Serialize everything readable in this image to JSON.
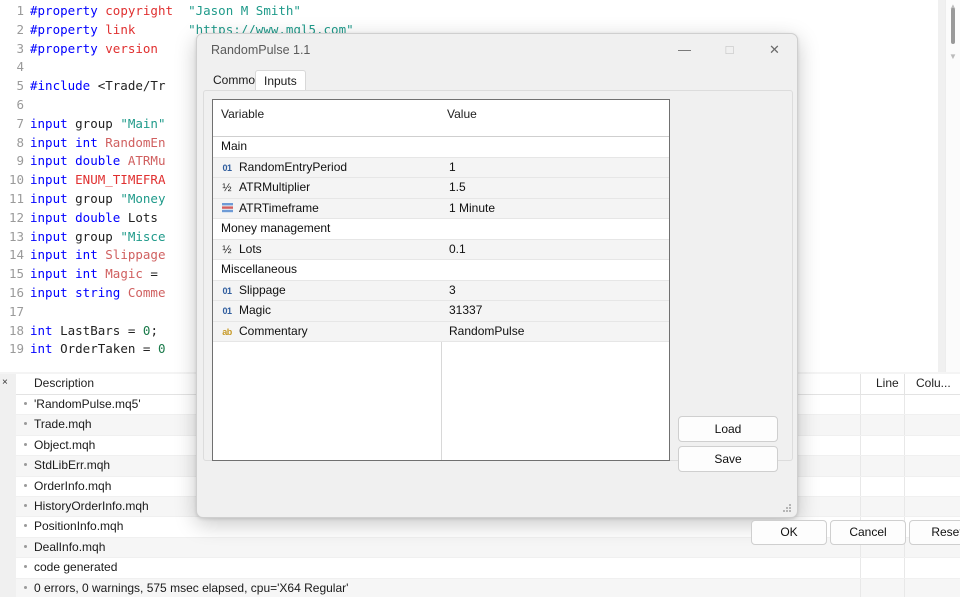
{
  "editor": {
    "lines": [
      {
        "n": "1",
        "tokens": [
          {
            "t": "#property ",
            "c": "pre"
          },
          {
            "t": "copyright",
            "c": "typ"
          },
          {
            "t": "  ",
            "c": "pln"
          },
          {
            "t": "\"Jason M Smith\"",
            "c": "str"
          }
        ]
      },
      {
        "n": "2",
        "tokens": [
          {
            "t": "#property ",
            "c": "pre"
          },
          {
            "t": "link",
            "c": "typ"
          },
          {
            "t": "       ",
            "c": "pln"
          },
          {
            "t": "\"https://www.mql5.com\"",
            "c": "str"
          }
        ]
      },
      {
        "n": "3",
        "tokens": [
          {
            "t": "#property ",
            "c": "pre"
          },
          {
            "t": "version",
            "c": "typ"
          }
        ]
      },
      {
        "n": "4",
        "tokens": []
      },
      {
        "n": "5",
        "tokens": [
          {
            "t": "#include ",
            "c": "pre"
          },
          {
            "t": "<Trade/Tr",
            "c": "pln"
          }
        ]
      },
      {
        "n": "6",
        "tokens": []
      },
      {
        "n": "7",
        "tokens": [
          {
            "t": "input ",
            "c": "kw"
          },
          {
            "t": "group ",
            "c": "pln"
          },
          {
            "t": "\"Main\"",
            "c": "str"
          }
        ]
      },
      {
        "n": "8",
        "tokens": [
          {
            "t": "input ",
            "c": "kw"
          },
          {
            "t": "int ",
            "c": "kw"
          },
          {
            "t": "RandomEn",
            "c": "id"
          }
        ]
      },
      {
        "n": "9",
        "tokens": [
          {
            "t": "input ",
            "c": "kw"
          },
          {
            "t": "double ",
            "c": "kw"
          },
          {
            "t": "ATRMu",
            "c": "id"
          }
        ]
      },
      {
        "n": "10",
        "tokens": [
          {
            "t": "input ",
            "c": "kw"
          },
          {
            "t": "ENUM_TIMEFRA",
            "c": "typ"
          }
        ]
      },
      {
        "n": "11",
        "tokens": [
          {
            "t": "input ",
            "c": "kw"
          },
          {
            "t": "group ",
            "c": "pln"
          },
          {
            "t": "\"Money",
            "c": "str"
          }
        ]
      },
      {
        "n": "12",
        "tokens": [
          {
            "t": "input ",
            "c": "kw"
          },
          {
            "t": "double ",
            "c": "kw"
          },
          {
            "t": "Lots ",
            "c": "pln"
          }
        ]
      },
      {
        "n": "13",
        "tokens": [
          {
            "t": "input ",
            "c": "kw"
          },
          {
            "t": "group ",
            "c": "pln"
          },
          {
            "t": "\"Misce",
            "c": "str"
          }
        ]
      },
      {
        "n": "14",
        "tokens": [
          {
            "t": "input ",
            "c": "kw"
          },
          {
            "t": "int ",
            "c": "kw"
          },
          {
            "t": "Slippage",
            "c": "id"
          }
        ]
      },
      {
        "n": "15",
        "tokens": [
          {
            "t": "input ",
            "c": "kw"
          },
          {
            "t": "int ",
            "c": "kw"
          },
          {
            "t": "Magic",
            "c": "id"
          },
          {
            "t": " = ",
            "c": "pln"
          }
        ]
      },
      {
        "n": "16",
        "tokens": [
          {
            "t": "input ",
            "c": "kw"
          },
          {
            "t": "string ",
            "c": "kw"
          },
          {
            "t": "Comme",
            "c": "id"
          }
        ]
      },
      {
        "n": "17",
        "tokens": []
      },
      {
        "n": "18",
        "tokens": [
          {
            "t": "int ",
            "c": "kw"
          },
          {
            "t": "LastBars = ",
            "c": "pln"
          },
          {
            "t": "0",
            "c": "num"
          },
          {
            "t": ";",
            "c": "pln"
          }
        ]
      },
      {
        "n": "19",
        "tokens": [
          {
            "t": "int ",
            "c": "kw"
          },
          {
            "t": "OrderTaken = ",
            "c": "pln"
          },
          {
            "t": "0",
            "c": "num"
          }
        ]
      }
    ]
  },
  "dialog": {
    "title": "RandomPulse 1.1",
    "window_controls": {
      "minimize": "—",
      "maximize": "□",
      "close": "✕"
    },
    "tabs": [
      {
        "label": "Common",
        "active": false
      },
      {
        "label": "Inputs",
        "active": true
      }
    ],
    "grid": {
      "headers": [
        "Variable",
        "Value"
      ],
      "rows": [
        {
          "kind": "group",
          "icon": "",
          "icon_type": "",
          "name": "Main",
          "value": ""
        },
        {
          "kind": "item",
          "icon": "01",
          "icon_type": "int",
          "name": "RandomEntryPeriod",
          "value": "1"
        },
        {
          "kind": "item",
          "icon": "½",
          "icon_type": "dbl",
          "name": "ATRMultiplier",
          "value": "1.5"
        },
        {
          "kind": "item",
          "icon": "",
          "icon_type": "enm",
          "name": "ATRTimeframe",
          "value": "1 Minute"
        },
        {
          "kind": "group",
          "icon": "",
          "icon_type": "",
          "name": "Money management",
          "value": ""
        },
        {
          "kind": "item",
          "icon": "½",
          "icon_type": "dbl",
          "name": "Lots",
          "value": "0.1"
        },
        {
          "kind": "group",
          "icon": "",
          "icon_type": "",
          "name": "Miscellaneous",
          "value": ""
        },
        {
          "kind": "item",
          "icon": "01",
          "icon_type": "int",
          "name": "Slippage",
          "value": "3"
        },
        {
          "kind": "item",
          "icon": "01",
          "icon_type": "int",
          "name": "Magic",
          "value": "31337"
        },
        {
          "kind": "item",
          "icon": "ab",
          "icon_type": "str",
          "name": "Commentary",
          "value": "RandomPulse"
        }
      ]
    },
    "buttons": {
      "load": "Load",
      "save": "Save",
      "ok": "OK",
      "cancel": "Cancel",
      "reset": "Reset"
    }
  },
  "bottom_panel": {
    "close_label": "×",
    "headers": {
      "description": "Description",
      "line": "Line",
      "column": "Colu..."
    },
    "rows": [
      {
        "desc": "'RandomPulse.mq5'"
      },
      {
        "desc": "Trade.mqh"
      },
      {
        "desc": "Object.mqh"
      },
      {
        "desc": "StdLibErr.mqh"
      },
      {
        "desc": "OrderInfo.mqh"
      },
      {
        "desc": "HistoryOrderInfo.mqh"
      },
      {
        "desc": "PositionInfo.mqh"
      },
      {
        "desc": "DealInfo.mqh"
      },
      {
        "desc": "code generated"
      },
      {
        "desc": "0 errors, 0 warnings, 575 msec elapsed, cpu='X64 Regular'"
      }
    ]
  },
  "colors": {
    "dialog_bg": "#f0f0f0",
    "accent_keyword": "#0000ff",
    "accent_type": "#e03030",
    "accent_string": "#1f9a8a"
  }
}
